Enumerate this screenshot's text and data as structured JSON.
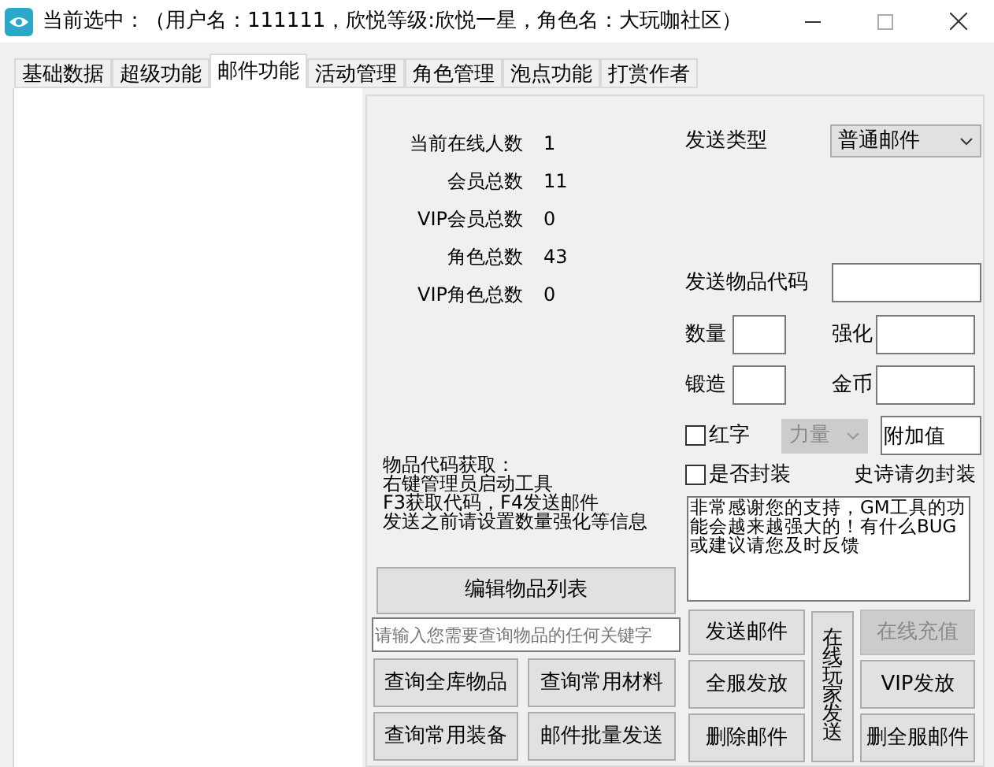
{
  "window": {
    "title": "当前选中：（用户名：111111，欣悦等级:欣悦一星，角色名：大玩咖社区）"
  },
  "tabs": [
    {
      "label": "基础数据",
      "selected": false
    },
    {
      "label": "超级功能",
      "selected": false
    },
    {
      "label": "邮件功能",
      "selected": true
    },
    {
      "label": "活动管理",
      "selected": false
    },
    {
      "label": "角色管理",
      "selected": false
    },
    {
      "label": "泡点功能",
      "selected": false
    },
    {
      "label": "打赏作者",
      "selected": false
    }
  ],
  "stats": [
    {
      "label": "当前在线人数",
      "value": "1"
    },
    {
      "label": "会员总数",
      "value": "11"
    },
    {
      "label": "VIP会员总数",
      "value": "0"
    },
    {
      "label": "角色总数",
      "value": "43"
    },
    {
      "label": "VIP角色总数",
      "value": "0"
    }
  ],
  "note_lines": [
    "物品代码获取：",
    "右键管理员启动工具",
    "F3获取代码，F4发送邮件",
    "发送之前请设置数量强化等信息"
  ],
  "edit_button": "编辑物品列表",
  "search": {
    "placeholder": "请输入您需要查询物品的任何关键字"
  },
  "query_buttons": [
    "查询全库物品",
    "查询常用材料",
    "查询常用装备",
    "邮件批量发送"
  ],
  "send_type": {
    "label": "发送类型",
    "value": "普通邮件"
  },
  "item_code": {
    "label": "发送物品代码"
  },
  "fields": [
    {
      "label": "数量"
    },
    {
      "label": "强化"
    },
    {
      "label": "锻造"
    },
    {
      "label": "金币"
    }
  ],
  "red_text": {
    "label": "红字",
    "checked": false
  },
  "attr_select": {
    "value": "力量",
    "disabled": true
  },
  "extra": {
    "value": "附加值"
  },
  "sealed": {
    "label": "是否封装",
    "checked": false
  },
  "seal_hint": "史诗请勿封装",
  "message": {
    "value": "非常感谢您的支持，GM工具的功能会越来越强大的！有什么BUG或建议请您及时反馈"
  },
  "action_buttons": [
    {
      "label": "发送邮件",
      "disabled": false
    },
    {
      "label": "在线玩家发送",
      "disabled": false
    },
    {
      "label": "在线充值",
      "disabled": true
    },
    {
      "label": "全服发放",
      "disabled": false
    },
    {
      "label": "VIP发放",
      "disabled": false
    },
    {
      "label": "删除邮件",
      "disabled": false
    },
    {
      "label": "删全服邮件",
      "disabled": false
    }
  ]
}
